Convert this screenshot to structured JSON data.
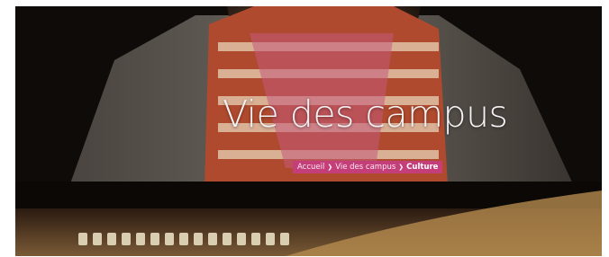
{
  "hero": {
    "title": "Vie des campus"
  },
  "breadcrumb": {
    "items": [
      "Accueil",
      "Vie des campus",
      "Culture"
    ],
    "separator_icon": "chevron-right-icon"
  },
  "colors": {
    "breadcrumb_bg": "#c43e7a",
    "title_text": "#f4f2f3"
  }
}
